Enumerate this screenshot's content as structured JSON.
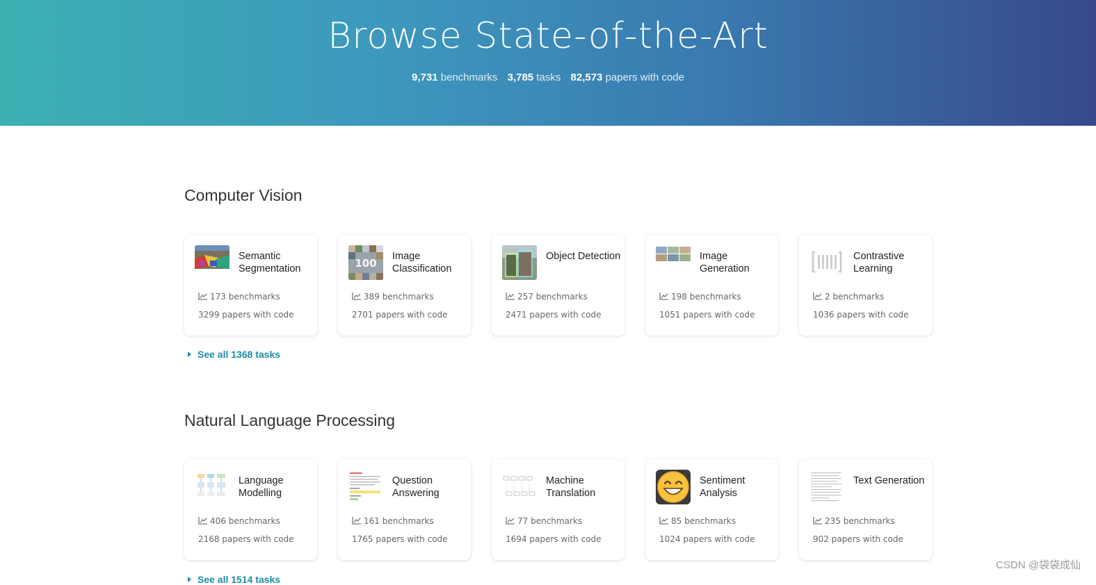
{
  "hero": {
    "title": "Browse State-of-the-Art",
    "stats": [
      {
        "num": "9,731",
        "label": "benchmarks"
      },
      {
        "num": "3,785",
        "label": "tasks"
      },
      {
        "num": "82,573",
        "label": "papers with code"
      }
    ]
  },
  "sections": [
    {
      "title": "Computer Vision",
      "see_all": "See all 1368 tasks",
      "cards": [
        {
          "name": "Semantic Segmentation",
          "benchmarks": "173 benchmarks",
          "papers": "3299 papers with code",
          "thumb": "segmentation-thumbnail"
        },
        {
          "name": "Image Classification",
          "benchmarks": "389 benchmarks",
          "papers": "2701 papers with code",
          "thumb": "classification-thumbnail"
        },
        {
          "name": "Object Detection",
          "benchmarks": "257 benchmarks",
          "papers": "2471 papers with code",
          "thumb": "detection-thumbnail"
        },
        {
          "name": "Image Generation",
          "benchmarks": "198 benchmarks",
          "papers": "1051 papers with code",
          "thumb": "generation-thumbnail"
        },
        {
          "name": "Contrastive Learning",
          "benchmarks": "2 benchmarks",
          "papers": "1036 papers with code",
          "thumb": "contrastive-thumbnail"
        }
      ]
    },
    {
      "title": "Natural Language Processing",
      "see_all": "See all 1514 tasks",
      "cards": [
        {
          "name": "Language Modelling",
          "benchmarks": "406 benchmarks",
          "papers": "2168 papers with code",
          "thumb": "language-modelling-thumbnail"
        },
        {
          "name": "Question Answering",
          "benchmarks": "161 benchmarks",
          "papers": "1765 papers with code",
          "thumb": "question-answering-thumbnail"
        },
        {
          "name": "Machine Translation",
          "benchmarks": "77 benchmarks",
          "papers": "1694 papers with code",
          "thumb": "machine-translation-thumbnail"
        },
        {
          "name": "Sentiment Analysis",
          "benchmarks": "85 benchmarks",
          "papers": "1024 papers with code",
          "thumb": "smiley-emoji"
        },
        {
          "name": "Text Generation",
          "benchmarks": "235 benchmarks",
          "papers": "902 papers with code",
          "thumb": "text-generation-thumbnail"
        }
      ]
    }
  ],
  "watermark": "CSDN @袋袋成仙",
  "colors": {
    "accent": "#1a8ea5",
    "hero_start": "#3bb0b2",
    "hero_end": "#37498a"
  }
}
